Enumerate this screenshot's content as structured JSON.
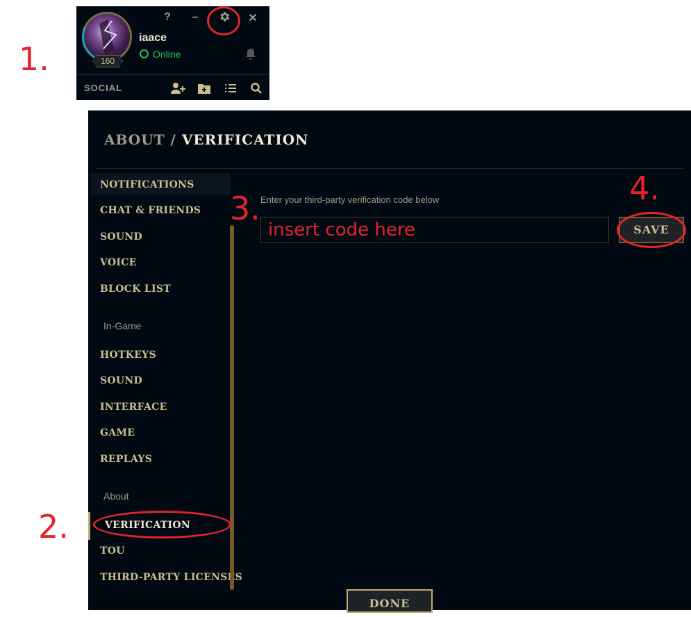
{
  "steps": {
    "s1": "1.",
    "s2": "2.",
    "s3": "3.",
    "s4": "4."
  },
  "social": {
    "username": "iaace",
    "status": "Online",
    "level": "160",
    "label": "SOCIAL",
    "window_icons": [
      "help-icon",
      "minimize-icon",
      "gear-icon",
      "close-icon"
    ],
    "help_glyph": "?",
    "minimize_glyph": "–",
    "close_glyph": "✕",
    "bar_icons": [
      "add-friend-icon",
      "add-folder-icon",
      "list-icon",
      "search-icon"
    ],
    "status_color": "#2dc45a"
  },
  "settings": {
    "breadcrumb": {
      "parent": "ABOUT",
      "separator": "/",
      "current": "VERIFICATION"
    },
    "client_items": [
      "NOTIFICATIONS",
      "CHAT & FRIENDS",
      "SOUND",
      "VOICE",
      "BLOCK LIST"
    ],
    "ingame_header": "In-Game",
    "ingame_items": [
      "HOTKEYS",
      "SOUND",
      "INTERFACE",
      "GAME",
      "REPLAYS"
    ],
    "about_header": "About",
    "about_items": [
      "VERIFICATION",
      "TOU",
      "THIRD-PARTY LICENSES"
    ],
    "selected_item": "VERIFICATION",
    "content_label": "Enter your third-party verification code below",
    "code_placeholder": "insert code here",
    "save_label": "SAVE",
    "done_label": "DONE"
  },
  "colors": {
    "annotation": "#e4232b",
    "gold": "#c8aa6e",
    "background": "#010a13"
  }
}
